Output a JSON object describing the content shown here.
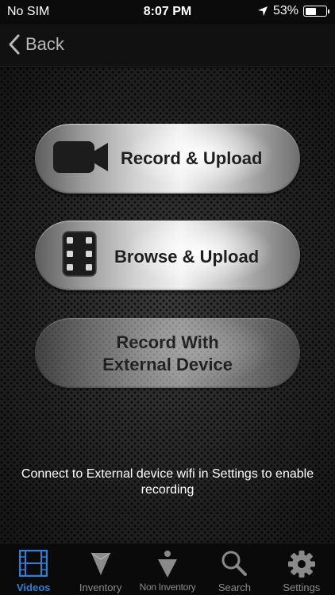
{
  "status": {
    "carrier": "No SIM",
    "time": "8:07 PM",
    "battery_percent": "53%",
    "battery_level": 0.53
  },
  "nav": {
    "back_label": "Back"
  },
  "buttons": {
    "record_upload": "Record & Upload",
    "browse_upload": "Browse & Upload",
    "external_line1": "Record With",
    "external_line2": "External Device"
  },
  "info": {
    "message": "Connect to External device wifi in Settings to enable recording"
  },
  "tabs": [
    {
      "label": "Videos",
      "icon": "film-icon",
      "active": true
    },
    {
      "label": "Inventory",
      "icon": "inventory-icon",
      "active": false
    },
    {
      "label": "Non Inventory",
      "icon": "non-inventory-icon",
      "active": false
    },
    {
      "label": "Search",
      "icon": "search-icon",
      "active": false
    },
    {
      "label": "Settings",
      "icon": "gear-icon",
      "active": false
    }
  ],
  "colors": {
    "accent": "#2f7fd8",
    "tab_inactive": "#8a8a8a",
    "background": "#232323"
  }
}
